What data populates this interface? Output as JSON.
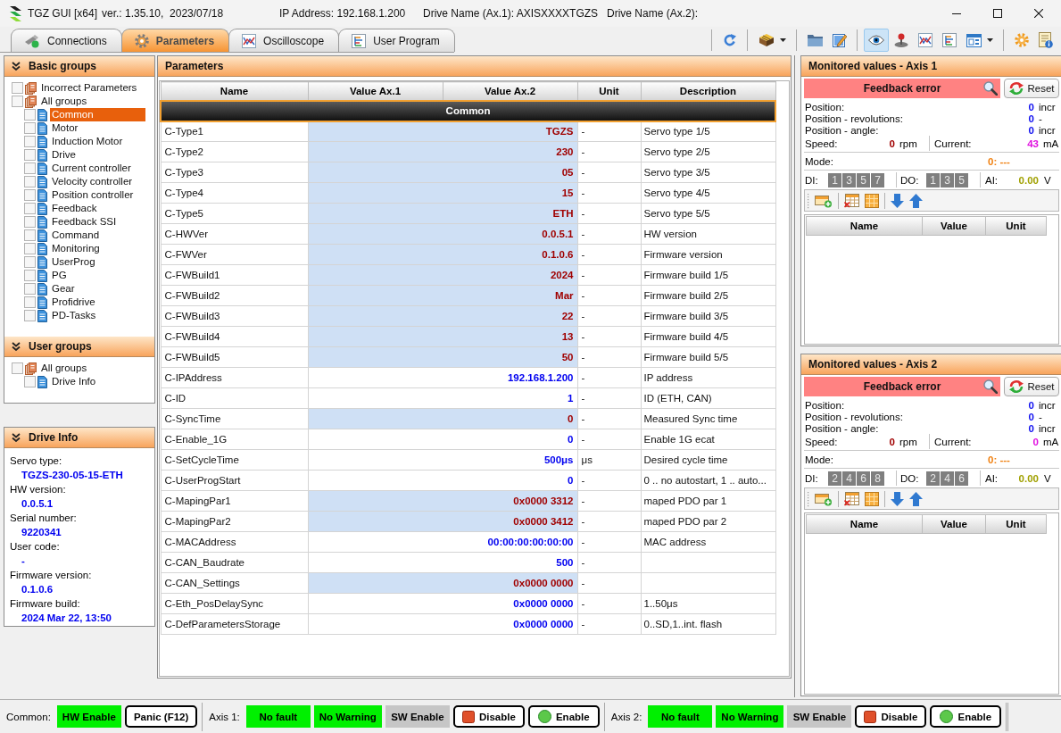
{
  "window": {
    "title": "TGZ GUI [x64]",
    "version": "ver.: 1.35.10,  2023/07/18",
    "ip_address": "IP Address: 192.168.1.200",
    "drive_name_ax1": "Drive Name (Ax.1): AXISXXXXTGZS",
    "drive_name_ax2": "Drive Name (Ax.2):"
  },
  "tabs": [
    {
      "label": "Connections",
      "selected": false
    },
    {
      "label": "Parameters",
      "selected": true
    },
    {
      "label": "Oscilloscope",
      "selected": false
    },
    {
      "label": "User Program",
      "selected": false
    }
  ],
  "toolbar": [
    {
      "selected": false
    },
    {
      "selected": false
    },
    {
      "selected": false
    },
    {
      "selected": false
    },
    {
      "selected": true
    },
    {
      "selected": false
    },
    {
      "selected": false
    },
    {
      "selected": false
    },
    {
      "selected": false
    },
    {
      "selected": false
    },
    {
      "selected": false
    }
  ],
  "sidebar": {
    "basic_groups": {
      "title": "Basic groups",
      "items": [
        {
          "label": "Incorrect Parameters",
          "checked": false,
          "selected": false
        },
        {
          "label": "All groups",
          "checked": false,
          "selected": false,
          "children": [
            {
              "label": "Common",
              "checked": false,
              "selected": true
            },
            {
              "label": "Motor",
              "checked": false,
              "selected": false
            },
            {
              "label": "Induction Motor",
              "checked": false,
              "selected": false
            },
            {
              "label": "Drive",
              "checked": false,
              "selected": false
            },
            {
              "label": "Current controller",
              "checked": false,
              "selected": false
            },
            {
              "label": "Velocity controller",
              "checked": false,
              "selected": false
            },
            {
              "label": "Position controller",
              "checked": false,
              "selected": false
            },
            {
              "label": "Feedback",
              "checked": false,
              "selected": false
            },
            {
              "label": "Feedback SSI",
              "checked": false,
              "selected": false
            },
            {
              "label": "Command",
              "checked": false,
              "selected": false
            },
            {
              "label": "Monitoring",
              "checked": false,
              "selected": false
            },
            {
              "label": "UserProg",
              "checked": false,
              "selected": false
            },
            {
              "label": "PG",
              "checked": false,
              "selected": false
            },
            {
              "label": "Gear",
              "checked": false,
              "selected": false
            },
            {
              "label": "Profidrive",
              "checked": false,
              "selected": false
            },
            {
              "label": "PD-Tasks",
              "checked": false,
              "selected": false
            }
          ]
        }
      ]
    },
    "user_groups": {
      "title": "User groups",
      "items": [
        {
          "label": "All groups",
          "checked": false,
          "selected": false,
          "children": [
            {
              "label": "Drive Info",
              "checked": false,
              "selected": false
            }
          ]
        }
      ]
    }
  },
  "drive_info": {
    "title": "Drive Info",
    "fields": [
      {
        "label": "Servo type:",
        "value": "TGZS-230-05-15-ETH"
      },
      {
        "label": "HW version:",
        "value": "0.0.5.1"
      },
      {
        "label": "Serial number:",
        "value": "9220341"
      },
      {
        "label": "User code:",
        "value": "-"
      },
      {
        "label": "Firmware version:",
        "value": "0.1.0.6"
      },
      {
        "label": "Firmware build:",
        "value": "2024 Mar 22, 13:50"
      }
    ]
  },
  "parameters": {
    "title": "Parameters",
    "columns": [
      "Name",
      "Value Ax.1",
      "Value Ax.2",
      "Unit",
      "Description"
    ],
    "group": "Common",
    "rows": [
      {
        "name": "C-Type1",
        "value_ax1": "TGZS",
        "unit": "-",
        "description": "Servo type 1/5",
        "read_only": true
      },
      {
        "name": "C-Type2",
        "value_ax1": "230",
        "unit": "-",
        "description": "Servo type 2/5",
        "read_only": true
      },
      {
        "name": "C-Type3",
        "value_ax1": "05",
        "unit": "-",
        "description": "Servo type 3/5",
        "read_only": true
      },
      {
        "name": "C-Type4",
        "value_ax1": "15",
        "unit": "-",
        "description": "Servo type 4/5",
        "read_only": true
      },
      {
        "name": "C-Type5",
        "value_ax1": "ETH",
        "unit": "-",
        "description": "Servo type 5/5",
        "read_only": true
      },
      {
        "name": "C-HWVer",
        "value_ax1": "0.0.5.1",
        "unit": "-",
        "description": "HW version",
        "read_only": true
      },
      {
        "name": "C-FWVer",
        "value_ax1": "0.1.0.6",
        "unit": "-",
        "description": "Firmware version",
        "read_only": true
      },
      {
        "name": "C-FWBuild1",
        "value_ax1": "2024",
        "unit": "-",
        "description": "Firmware build 1/5",
        "read_only": true
      },
      {
        "name": "C-FWBuild2",
        "value_ax1": "Mar",
        "unit": "-",
        "description": "Firmware build 2/5",
        "read_only": true
      },
      {
        "name": "C-FWBuild3",
        "value_ax1": "22",
        "unit": "-",
        "description": "Firmware build 3/5",
        "read_only": true
      },
      {
        "name": "C-FWBuild4",
        "value_ax1": "13",
        "unit": "-",
        "description": "Firmware build 4/5",
        "read_only": true
      },
      {
        "name": "C-FWBuild5",
        "value_ax1": "50",
        "unit": "-",
        "description": "Firmware build 5/5",
        "read_only": true
      },
      {
        "name": "C-IPAddress",
        "value_ax1": "192.168.1.200",
        "unit": "-",
        "description": "IP address",
        "read_only": false
      },
      {
        "name": "C-ID",
        "value_ax1": "1",
        "unit": "-",
        "description": "ID (ETH, CAN)",
        "read_only": false
      },
      {
        "name": "C-SyncTime",
        "value_ax1": "0",
        "unit": "-",
        "description": "Measured Sync time",
        "read_only": true
      },
      {
        "name": "C-Enable_1G",
        "value_ax1": "0",
        "unit": "-",
        "description": "Enable 1G ecat",
        "read_only": false
      },
      {
        "name": "C-SetCycleTime",
        "value_ax1": "500μs",
        "unit": "μs",
        "description": "Desired cycle time",
        "read_only": false
      },
      {
        "name": "C-UserProgStart",
        "value_ax1": "0",
        "unit": "-",
        "description": "0 .. no autostart, 1 .. auto...",
        "read_only": false
      },
      {
        "name": "C-MapingPar1",
        "value_ax1": "0x0000 3312",
        "unit": "-",
        "description": "maped PDO par 1",
        "read_only": true
      },
      {
        "name": "C-MapingPar2",
        "value_ax1": "0x0000 3412",
        "unit": "-",
        "description": "maped PDO par 2",
        "read_only": true
      },
      {
        "name": "C-MACAddress",
        "value_ax1": "00:00:00:00:00:00",
        "unit": "-",
        "description": "MAC address",
        "read_only": false
      },
      {
        "name": "C-CAN_Baudrate",
        "value_ax1": "500",
        "unit": "-",
        "read_only": false
      },
      {
        "name": "C-CAN_Settings",
        "value_ax1": "0x0000 0000",
        "unit": "-",
        "read_only": true
      },
      {
        "name": "C-Eth_PosDelaySync",
        "value_ax1": "0x0000 0000",
        "unit": "-",
        "description": "1..50μs",
        "read_only": false
      },
      {
        "name": "C-DefParametersStorage",
        "value_ax1": "0x0000 0000",
        "unit": "-",
        "description": "0..SD,1..int. flash",
        "read_only": false
      }
    ]
  },
  "monitors": [
    {
      "title": "Monitored values - Axis 1",
      "status": "Feedback error",
      "reset": "Reset",
      "readings": [
        {
          "label": "Position:",
          "value": "0",
          "unit": "incr"
        },
        {
          "label": "Position - revolutions:",
          "value": "0",
          "unit": "-"
        },
        {
          "label": "Position - angle:",
          "value": "0",
          "unit": "incr"
        }
      ],
      "speed": {
        "label": "Speed:",
        "value": "0",
        "unit": "rpm"
      },
      "current": {
        "label": "Current:",
        "value": "43",
        "unit": "mA"
      },
      "mode": {
        "label": "Mode:",
        "value": "0: ---"
      },
      "di": {
        "label": "DI:",
        "bits": [
          "1",
          "3",
          "5",
          "7"
        ]
      },
      "do": {
        "label": "DO:",
        "bits": [
          "1",
          "3",
          "5"
        ]
      },
      "ai": {
        "label": "AI:",
        "value": "0.00",
        "unit": "V"
      },
      "columns": [
        "Name",
        "Value",
        "Unit"
      ]
    },
    {
      "title": "Monitored values - Axis 2",
      "status": "Feedback error",
      "reset": "Reset",
      "readings": [
        {
          "label": "Position:",
          "value": "0",
          "unit": "incr"
        },
        {
          "label": "Position - revolutions:",
          "value": "0",
          "unit": "-"
        },
        {
          "label": "Position - angle:",
          "value": "0",
          "unit": "incr"
        }
      ],
      "speed": {
        "label": "Speed:",
        "value": "0",
        "unit": "rpm"
      },
      "current": {
        "label": "Current:",
        "value": "0",
        "unit": "mA"
      },
      "mode": {
        "label": "Mode:",
        "value": "0: ---"
      },
      "di": {
        "label": "DI:",
        "bits": [
          "2",
          "4",
          "6",
          "8"
        ]
      },
      "do": {
        "label": "DO:",
        "bits": [
          "2",
          "4",
          "6"
        ]
      },
      "ai": {
        "label": "AI:",
        "value": "0.00",
        "unit": "V"
      },
      "columns": [
        "Name",
        "Value",
        "Unit"
      ]
    }
  ],
  "status_bar": {
    "sections": [
      {
        "label": "Common:",
        "items": [
          {
            "kind": "indicator",
            "label": "HW Enable",
            "on": true
          },
          {
            "kind": "button",
            "label": "Panic (F12)"
          }
        ]
      },
      {
        "label": "Axis 1:",
        "items": [
          {
            "kind": "indicator",
            "label": "No fault",
            "on": true
          },
          {
            "kind": "indicator",
            "label": "No Warning",
            "on": true
          },
          {
            "kind": "indicator",
            "label": "SW Enable",
            "on": false
          },
          {
            "kind": "stop",
            "label": "Disable"
          },
          {
            "kind": "go",
            "label": "Enable"
          }
        ]
      },
      {
        "label": "Axis 2:",
        "items": [
          {
            "kind": "indicator",
            "label": "No fault",
            "on": true
          },
          {
            "kind": "indicator",
            "label": "No Warning",
            "on": true
          },
          {
            "kind": "indicator",
            "label": "SW Enable",
            "on": false
          },
          {
            "kind": "stop",
            "label": "Disable"
          },
          {
            "kind": "go",
            "label": "Enable"
          }
        ]
      }
    ]
  }
}
